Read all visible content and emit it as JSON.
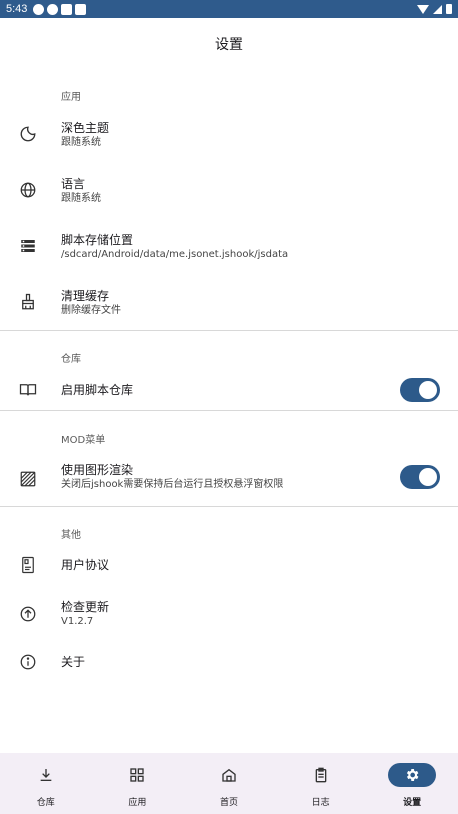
{
  "status_bar": {
    "time": "5:43"
  },
  "header": {
    "title": "设置"
  },
  "sections": {
    "app": {
      "header": "应用",
      "items": [
        {
          "title": "深色主题",
          "subtitle": "跟随系统",
          "icon": "moon-icon"
        },
        {
          "title": "语言",
          "subtitle": "跟随系统",
          "icon": "globe-icon"
        },
        {
          "title": "脚本存储位置",
          "subtitle": "/sdcard/Android/data/me.jsonet.jshook/jsdata",
          "icon": "storage-icon"
        },
        {
          "title": "清理缓存",
          "subtitle": "删除缓存文件",
          "icon": "broom-icon"
        }
      ]
    },
    "repo": {
      "header": "仓库",
      "items": [
        {
          "title": "启用脚本仓库",
          "icon": "book-icon",
          "toggle": true
        }
      ]
    },
    "mod": {
      "header": "MOD菜单",
      "items": [
        {
          "title": "使用图形渲染",
          "subtitle": "关闭后jshook需要保持后台运行且授权悬浮窗权限",
          "icon": "texture-icon",
          "toggle": true
        }
      ]
    },
    "other": {
      "header": "其他",
      "items": [
        {
          "title": "用户协议",
          "icon": "document-icon"
        },
        {
          "title": "检查更新",
          "subtitle": "V1.2.7",
          "icon": "upload-icon"
        },
        {
          "title": "关于",
          "icon": "info-icon"
        }
      ]
    }
  },
  "bottom_nav": {
    "items": [
      {
        "label": "仓库",
        "icon": "download-icon",
        "active": false
      },
      {
        "label": "应用",
        "icon": "apps-grid-icon",
        "active": false
      },
      {
        "label": "首页",
        "icon": "home-icon",
        "active": false
      },
      {
        "label": "日志",
        "icon": "clipboard-icon",
        "active": false
      },
      {
        "label": "设置",
        "icon": "gear-icon",
        "active": true
      }
    ]
  },
  "colors": {
    "accent": "#2d5a8a",
    "status_bar": "#2f5b8c",
    "nav_background": "#f3eef6"
  }
}
